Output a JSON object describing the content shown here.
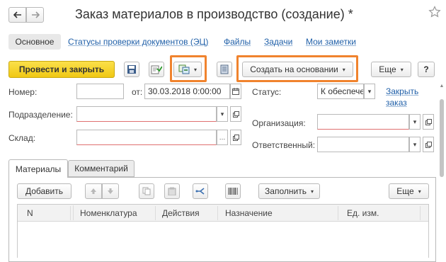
{
  "window": {
    "title": "Заказ материалов в производство (создание) *",
    "star_icon": "star-outline-icon"
  },
  "nav_tabs": [
    {
      "label": "Основное"
    },
    {
      "label": "Статусы проверки документов (ЭЦ)"
    },
    {
      "label": "Файлы"
    },
    {
      "label": "Задачи"
    },
    {
      "label": "Мои заметки"
    }
  ],
  "toolbar": {
    "post_close_label": "Провести и закрыть",
    "create_basis_label": "Создать на основании",
    "more_label": "Еще",
    "help_label": "?"
  },
  "form": {
    "number_label": "Номер:",
    "number_value": "",
    "from_label": "от:",
    "date_value": "30.03.2018  0:00:00",
    "status_label": "Статус:",
    "status_value": "К обеспече",
    "close_order_link": "Закрыть заказ",
    "division_label": "Подразделение:",
    "division_value": "",
    "organization_label": "Организация:",
    "organization_value": "",
    "warehouse_label": "Склад:",
    "warehouse_value": "",
    "responsible_label": "Ответственный:",
    "responsible_value": ""
  },
  "inner_tabs": [
    {
      "label": "Материалы"
    },
    {
      "label": "Комментарий"
    }
  ],
  "table_toolbar": {
    "add_label": "Добавить",
    "fill_label": "Заполнить",
    "more_label": "Еще"
  },
  "table": {
    "columns": [
      "N",
      "Номенклатура",
      "Действия",
      "Назначение",
      "Ед. изм."
    ]
  },
  "colors": {
    "primary_button": "#f5d01f",
    "highlight_border": "#f0832e",
    "link": "#1f5fa8"
  }
}
